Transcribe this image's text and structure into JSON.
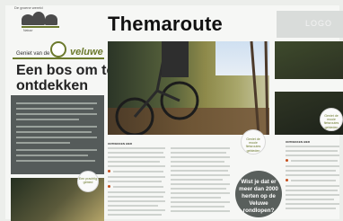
{
  "header": {
    "title": "Themaroute",
    "logo_text_top": "De groene wereld",
    "logo_text_bottom": "Natuur",
    "grey_box_label": "LOGO"
  },
  "left_page": {
    "brand_prefix": "Geniet van de",
    "brand_name": "veluwe",
    "heading": "Een bos om te ontdekken",
    "bubble_text": "Een prachtig gebied"
  },
  "captions": {
    "circle_1": "Geniet de mooie fietsroutes gebieden",
    "circle_2": "Geniet de mooie fietsroutes gebieden",
    "quote": "Wist je dat er meer dan 2000 herten op de Veluwe rondlopen?"
  },
  "columns": {
    "title_1": "ONTDEKKEN HIER",
    "title_2": "ONTDEKKEN HIER"
  }
}
